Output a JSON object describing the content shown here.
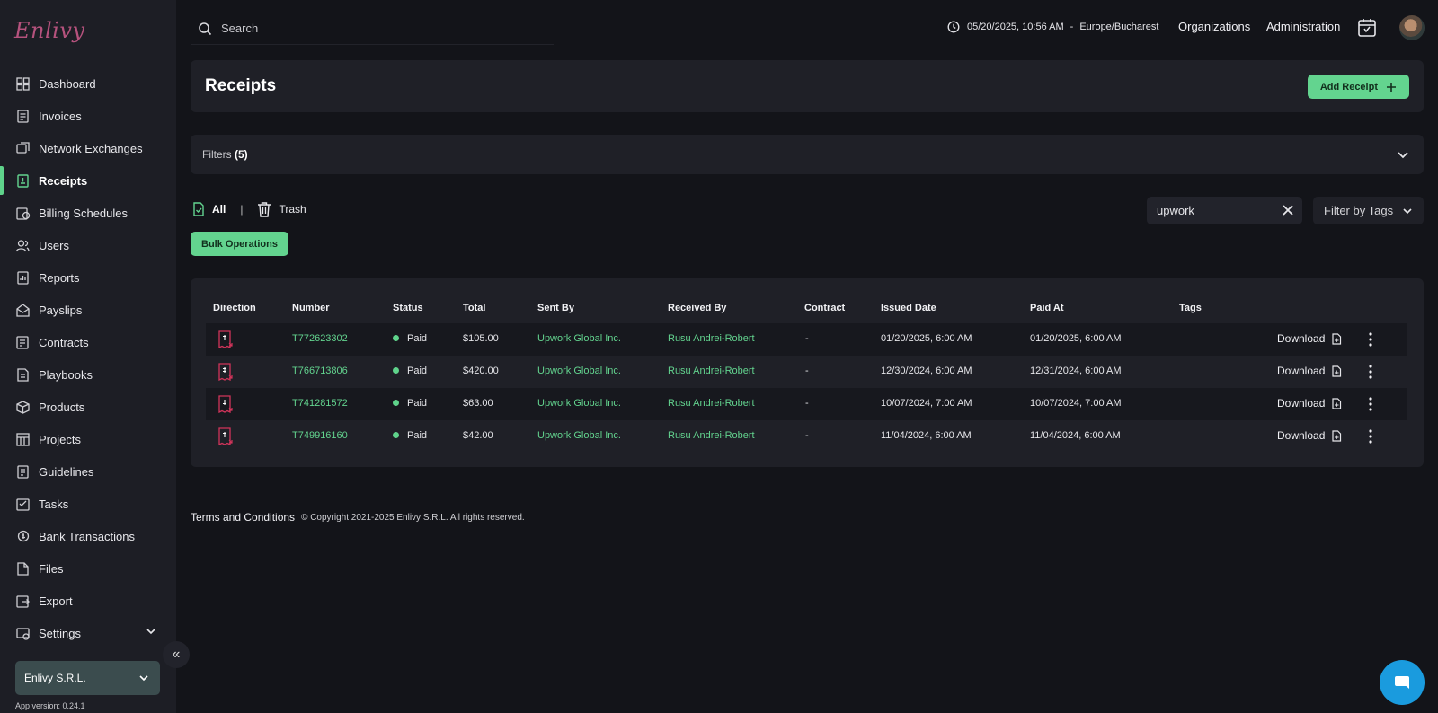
{
  "brand": {
    "logo_text": "Enlivy"
  },
  "sidebar": {
    "items": [
      {
        "label": "Dashboard",
        "icon": "dashboard-icon"
      },
      {
        "label": "Invoices",
        "icon": "invoice-icon"
      },
      {
        "label": "Network Exchanges",
        "icon": "network-exchange-icon"
      },
      {
        "label": "Receipts",
        "icon": "receipt-icon",
        "active": true
      },
      {
        "label": "Billing Schedules",
        "icon": "billing-schedule-icon"
      },
      {
        "label": "Users",
        "icon": "users-icon"
      },
      {
        "label": "Reports",
        "icon": "reports-icon"
      },
      {
        "label": "Payslips",
        "icon": "payslip-icon"
      },
      {
        "label": "Contracts",
        "icon": "contract-icon"
      },
      {
        "label": "Playbooks",
        "icon": "playbook-icon"
      },
      {
        "label": "Products",
        "icon": "product-icon"
      },
      {
        "label": "Projects",
        "icon": "project-icon"
      },
      {
        "label": "Guidelines",
        "icon": "guideline-icon"
      },
      {
        "label": "Tasks",
        "icon": "task-icon"
      },
      {
        "label": "Bank Transactions",
        "icon": "bank-transaction-icon"
      },
      {
        "label": "Files",
        "icon": "file-icon"
      },
      {
        "label": "Export",
        "icon": "export-icon"
      },
      {
        "label": "Settings",
        "icon": "settings-icon"
      }
    ],
    "org_name": "Enlivy S.R.L.",
    "app_version": "App version: 0.24.1"
  },
  "topbar": {
    "search_placeholder": "Search",
    "datetime": "05/20/2025, 10:56 AM",
    "separator": "-",
    "timezone": "Europe/Bucharest",
    "organizations_label": "Organizations",
    "administration_label": "Administration"
  },
  "page": {
    "title": "Receipts",
    "add_button_label": "Add Receipt",
    "filters_label": "Filters",
    "filters_count": "(5)",
    "tab_all": "All",
    "tab_separator": "|",
    "tab_trash": "Trash",
    "search_value": "upwork",
    "filter_by_tags_label": "Filter by Tags",
    "bulk_operations_label": "Bulk Operations"
  },
  "table": {
    "columns": [
      "Direction",
      "Number",
      "Status",
      "Total",
      "Sent By",
      "Received By",
      "Contract",
      "Issued Date",
      "Paid At",
      "Tags"
    ],
    "download_label": "Download",
    "rows": [
      {
        "number": "T772623302",
        "status": "Paid",
        "total": "$105.00",
        "sent_by": "Upwork Global Inc.",
        "received_by": "Rusu Andrei-Robert",
        "contract": "-",
        "issued_date": "01/20/2025, 6:00 AM",
        "paid_at": "01/20/2025, 6:00 AM"
      },
      {
        "number": "T766713806",
        "status": "Paid",
        "total": "$420.00",
        "sent_by": "Upwork Global Inc.",
        "received_by": "Rusu Andrei-Robert",
        "contract": "-",
        "issued_date": "12/30/2024, 6:00 AM",
        "paid_at": "12/31/2024, 6:00 AM"
      },
      {
        "number": "T741281572",
        "status": "Paid",
        "total": "$63.00",
        "sent_by": "Upwork Global Inc.",
        "received_by": "Rusu Andrei-Robert",
        "contract": "-",
        "issued_date": "10/07/2024, 7:00 AM",
        "paid_at": "10/07/2024, 7:00 AM"
      },
      {
        "number": "T749916160",
        "status": "Paid",
        "total": "$42.00",
        "sent_by": "Upwork Global Inc.",
        "received_by": "Rusu Andrei-Robert",
        "contract": "-",
        "issued_date": "11/04/2024, 6:00 AM",
        "paid_at": "11/04/2024, 6:00 AM"
      }
    ]
  },
  "footer": {
    "terms_label": "Terms and Conditions",
    "copyright": "© Copyright 2021-2025 Enlivy S.R.L. All rights reserved."
  },
  "colors": {
    "accent": "#63d48f",
    "background": "#131419",
    "sidebar": "#1d1e25",
    "card": "#1f2027",
    "chat": "#1a9bde",
    "direction_icon": "#d0345a"
  }
}
